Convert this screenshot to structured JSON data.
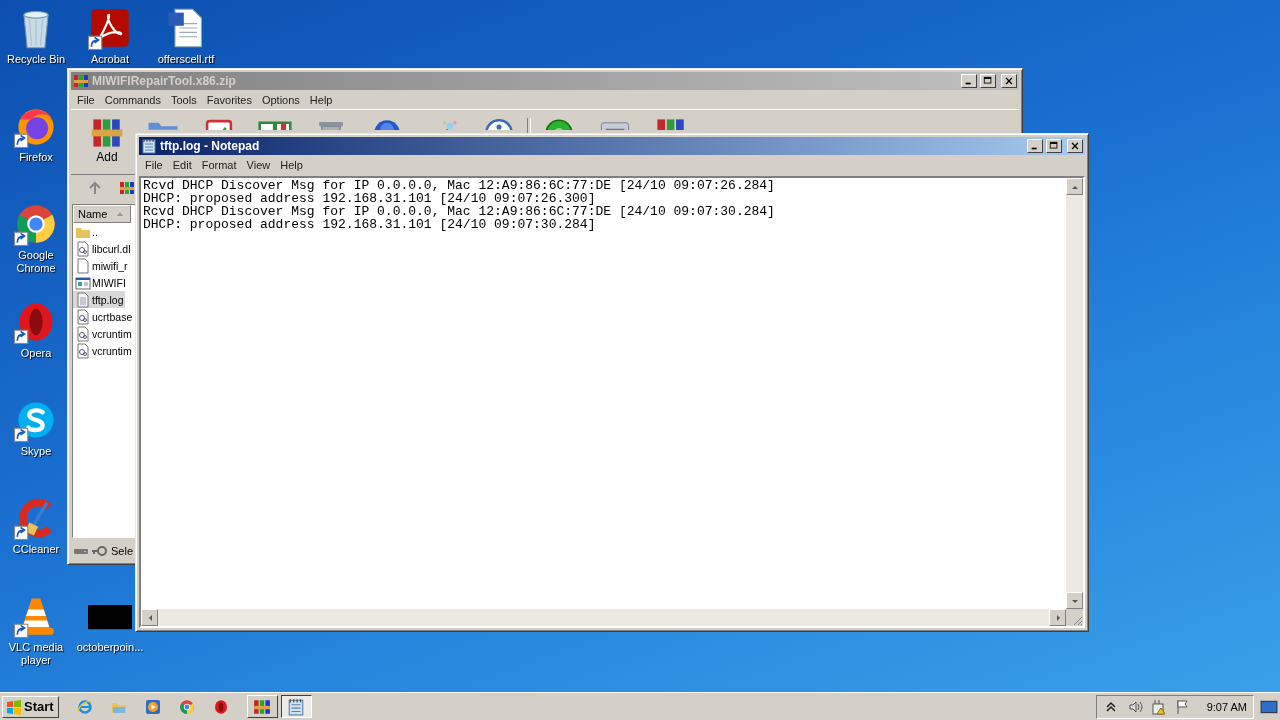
{
  "desktop": {
    "icons": [
      {
        "label": "Recycle Bin",
        "kind": "recycle",
        "shortcut": false
      },
      {
        "label": "Acrobat",
        "kind": "acrobat",
        "shortcut": true
      },
      {
        "label": "offerscell.rtf",
        "kind": "word",
        "shortcut": false
      },
      {
        "label": "Firefox",
        "kind": "firefox",
        "shortcut": true
      },
      {
        "label": "Google Chrome",
        "kind": "chrome",
        "shortcut": true
      },
      {
        "label": "Opera",
        "kind": "opera",
        "shortcut": true
      },
      {
        "label": "Skype",
        "kind": "skype",
        "shortcut": true
      },
      {
        "label": "CCleaner",
        "kind": "ccleaner",
        "shortcut": true
      },
      {
        "label": "VLC media player",
        "kind": "vlc",
        "shortcut": true
      },
      {
        "label": "octoberpoin...",
        "kind": "blank",
        "shortcut": false
      }
    ]
  },
  "archive_window": {
    "title": "MIWIFIRepairTool.x86.zip",
    "active": false,
    "menu": [
      "File",
      "Commands",
      "Tools",
      "Favorites",
      "Options",
      "Help"
    ],
    "toolbar": [
      {
        "kind": "add",
        "label": "Add"
      },
      {
        "kind": "extract"
      },
      {
        "kind": "test"
      },
      {
        "kind": "view"
      },
      {
        "kind": "delete"
      },
      {
        "kind": "find"
      },
      {
        "kind": "wizard"
      },
      {
        "kind": "info"
      },
      {
        "kind": "virus"
      },
      {
        "kind": "comment"
      },
      {
        "kind": "sfx"
      }
    ],
    "columns": [
      {
        "label": "Name",
        "sorted": true
      }
    ],
    "files": [
      {
        "name": "..",
        "kind": "up",
        "selected": false
      },
      {
        "name": "libcurl.dl",
        "kind": "dll",
        "selected": false
      },
      {
        "name": "miwifi_r",
        "kind": "file",
        "selected": false
      },
      {
        "name": "MIWIFI",
        "kind": "exe",
        "selected": false
      },
      {
        "name": "tftp.log",
        "kind": "log",
        "selected": true
      },
      {
        "name": "ucrtbase",
        "kind": "dll",
        "selected": false
      },
      {
        "name": "vcruntim",
        "kind": "dll",
        "selected": false
      },
      {
        "name": "vcruntim",
        "kind": "dll",
        "selected": false
      }
    ],
    "status": "Sele"
  },
  "notepad_window": {
    "title": "tftp.log - Notepad",
    "active": true,
    "menu": [
      "File",
      "Edit",
      "Format",
      "View",
      "Help"
    ],
    "lines": [
      "Rcvd DHCP Discover Msg for IP 0.0.0.0, Mac 12:A9:86:6C:77:DE [24/10 09:07:26.284]",
      "DHCP: proposed address 192.168.31.101 [24/10 09:07:26.300]",
      "Rcvd DHCP Discover Msg for IP 0.0.0.0, Mac 12:A9:86:6C:77:DE [24/10 09:07:30.284]",
      "DHCP: proposed address 192.168.31.101 [24/10 09:07:30.284]"
    ]
  },
  "taskbar": {
    "start": "Start",
    "quick_launch": [
      {
        "kind": "ie"
      },
      {
        "kind": "folder"
      },
      {
        "kind": "media"
      },
      {
        "kind": "chrome"
      },
      {
        "kind": "opera"
      }
    ],
    "tasks": [
      {
        "kind": "winrar",
        "selected": false
      },
      {
        "kind": "notepad",
        "selected": true
      }
    ],
    "tray": [
      {
        "kind": "chevron"
      },
      {
        "kind": "volume"
      },
      {
        "kind": "network"
      },
      {
        "kind": "flag"
      }
    ],
    "clock": "9:07 AM"
  }
}
